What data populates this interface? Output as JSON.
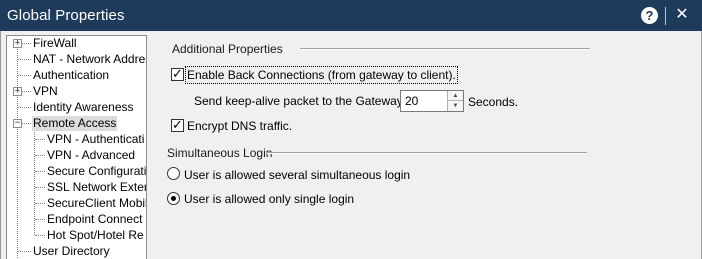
{
  "window": {
    "title": "Global Properties",
    "help_label": "?",
    "close_label": "✕"
  },
  "tree": {
    "items": [
      {
        "label": "FireWall"
      },
      {
        "label": "NAT - Network Addres"
      },
      {
        "label": "Authentication"
      },
      {
        "label": "VPN"
      },
      {
        "label": "Identity Awareness"
      },
      {
        "label": "Remote Access"
      },
      {
        "label": "VPN - Authenticati"
      },
      {
        "label": "VPN - Advanced"
      },
      {
        "label": "Secure Configurati"
      },
      {
        "label": "SSL Network Exter"
      },
      {
        "label": "SecureClient Mobil"
      },
      {
        "label": "Endpoint Connect"
      },
      {
        "label": "Hot Spot/Hotel Re"
      },
      {
        "label": "User Directory"
      }
    ],
    "expand_plus": "+",
    "expand_minus": "−"
  },
  "additional": {
    "title": "Additional Properties",
    "back_connections_label": "Enable Back Connections (from gateway to client).",
    "back_connections_checked": true,
    "keepalive_label": "Send keep-alive packet to the Gateway",
    "keepalive_value": "20",
    "keepalive_unit": "Seconds.",
    "encrypt_dns_label": "Encrypt DNS traffic.",
    "encrypt_dns_checked": true
  },
  "simultaneous": {
    "title": "Simultaneous Login",
    "options": [
      {
        "label": "User is allowed several simultaneous login",
        "selected": false
      },
      {
        "label": "User is allowed only single login",
        "selected": true
      }
    ]
  },
  "icons": {
    "check": "✓",
    "spin_up": "▲",
    "spin_down": "▼"
  }
}
